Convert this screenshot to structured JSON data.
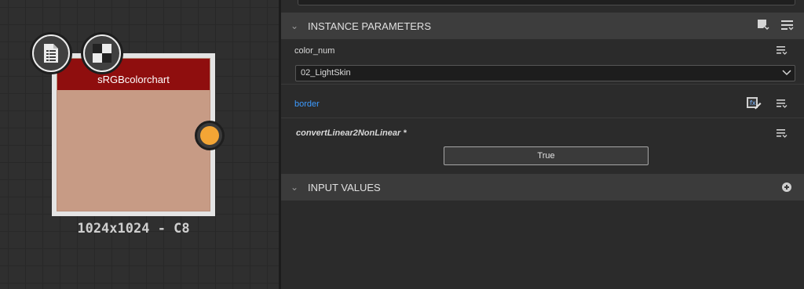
{
  "graph": {
    "node": {
      "title": "sRGBcolorchart",
      "caption": "1024x1024 - C8",
      "icons": [
        "document-icon",
        "checker-pattern-icon"
      ],
      "preview_color": "#c79b85",
      "title_color": "#8f0e0e",
      "output_port_color": "#f3a535"
    }
  },
  "panel": {
    "instance_parameters": {
      "title": "INSTANCE PARAMETERS",
      "params": {
        "color_num": {
          "label": "color_num",
          "value": "02_LightSkin"
        },
        "border": {
          "label": "border",
          "color": "#3d9bff"
        },
        "convert": {
          "label": "convertLinear2NonLinear *",
          "value": "True"
        }
      }
    },
    "input_values": {
      "title": "INPUT VALUES"
    }
  }
}
